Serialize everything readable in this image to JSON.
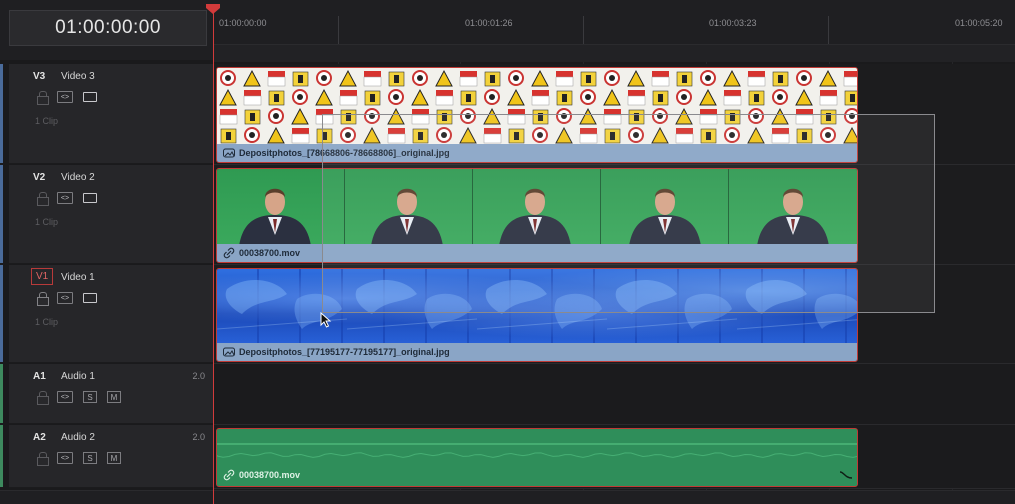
{
  "timecode": "01:00:00:00",
  "ruler": {
    "labels": [
      "01:00:00:00",
      "01:00:01:26",
      "01:00:03:23",
      "01:00:05:20"
    ]
  },
  "tracks": {
    "v3": {
      "id": "V3",
      "name": "Video 3",
      "clip_count": "1 Clip"
    },
    "v2": {
      "id": "V2",
      "name": "Video 2",
      "clip_count": "1 Clip"
    },
    "v1": {
      "id": "V1",
      "name": "Video 1",
      "clip_count": "1 Clip"
    },
    "a1": {
      "id": "A1",
      "name": "Audio 1",
      "channels": "2.0",
      "solo": "S",
      "mute": "M"
    },
    "a2": {
      "id": "A2",
      "name": "Audio 2",
      "channels": "2.0",
      "solo": "S",
      "mute": "M"
    }
  },
  "clips": {
    "v3": "Depositphotos_[78668806-78668806]_original.jpg",
    "v2": "00038700.mov",
    "v1": "Depositphotos_[77195177-77195177]_original.jpg",
    "a2": "00038700.mov"
  },
  "icons": {
    "lock": "lock-icon",
    "link": "link-icon",
    "auto_select": "auto-select-icon",
    "monitor": "monitor-icon",
    "image": "image-clip-icon",
    "playhead": "playhead-icon",
    "cursor": "mouse-cursor-icon",
    "fade": "fade-handle-icon"
  },
  "colors": {
    "playhead": "#d23b3b",
    "clip_border": "#c03a35",
    "video_label": "#8aa5c6",
    "audio_clip": "#2f8e5a"
  }
}
